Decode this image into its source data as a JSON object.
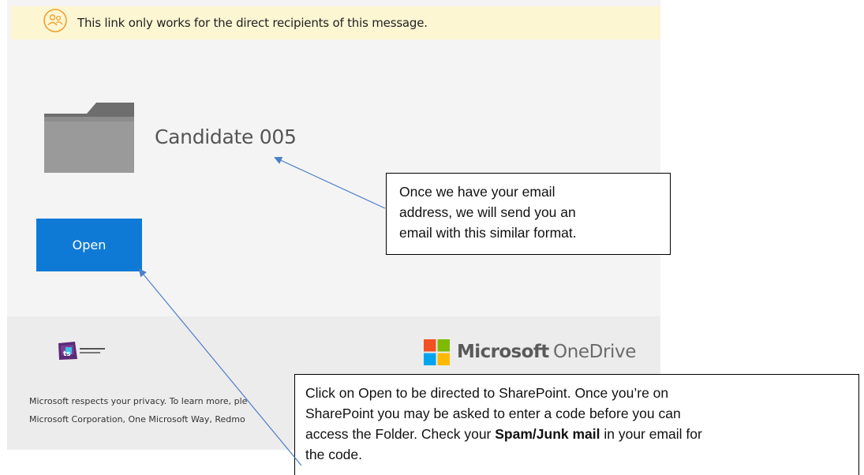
{
  "banner": {
    "text": "This link only works for the direct recipients of this message.",
    "icon": "people-circle-icon"
  },
  "folder": {
    "icon": "folder-icon",
    "name": "Candidate 005"
  },
  "open_button": {
    "label": "Open"
  },
  "footer": {
    "company_logo": "company-logo",
    "brand": {
      "microsoft": "Microsoft",
      "onedrive": "OneDrive"
    },
    "privacy_line_1": "Microsoft respects your privacy. To learn more, ple",
    "privacy_line_2": "Microsoft Corporation, One Microsoft Way, Redmo"
  },
  "callouts": {
    "email": {
      "line_1": "Once we have your email",
      "line_2": "address, we will send you an",
      "line_3": "email with this similar format."
    },
    "open": {
      "line_1": "Click on Open to be directed to SharePoint. Once you’re on",
      "line_2": "SharePoint you may be asked to enter a code before you can",
      "line_3": "access the Folder. Check your ",
      "line_3_bold": "Spam/Junk mail",
      "line_3_end": " in your email for",
      "line_4": "the code."
    }
  },
  "colors": {
    "banner_bg": "#fdf6d3",
    "accent_orange": "#f0a030",
    "button_blue": "#0f7ad6",
    "arrow_blue": "#4a7fc8",
    "ms_red": "#f25022",
    "ms_green": "#7fba00",
    "ms_blue": "#00a4ef",
    "ms_yellow": "#ffb900"
  }
}
